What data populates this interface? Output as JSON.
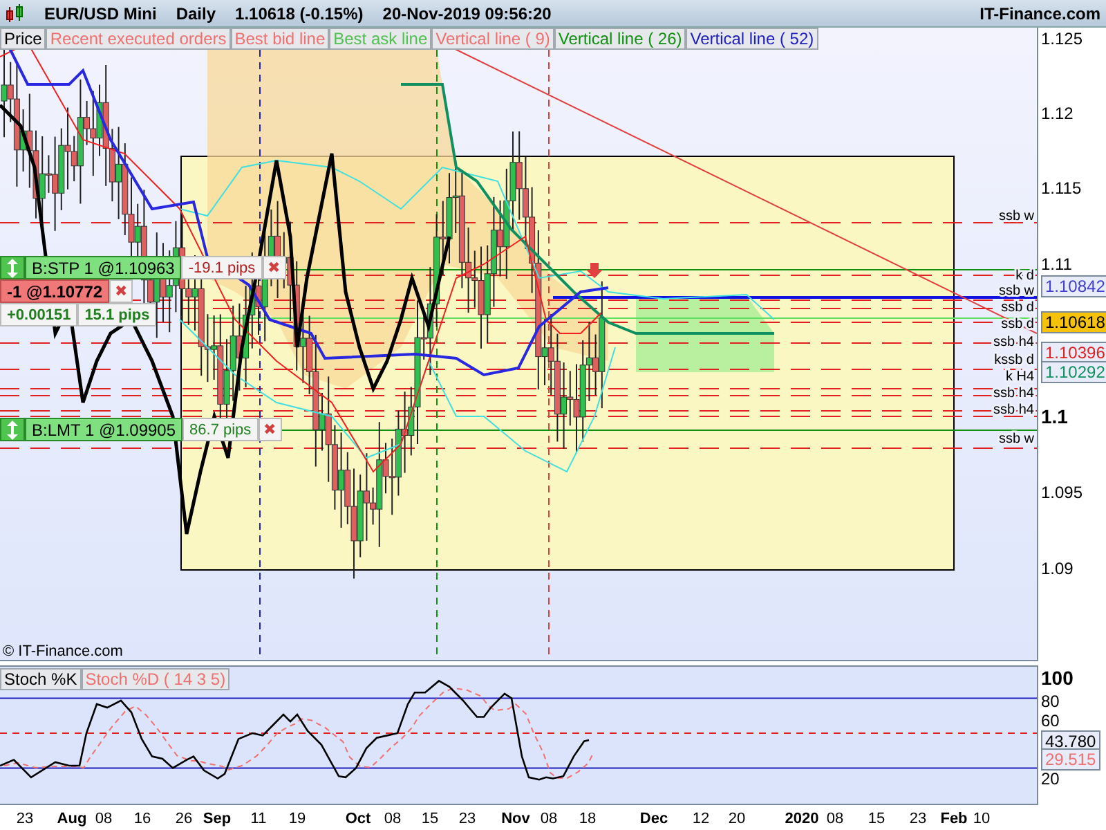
{
  "header": {
    "symbol": "EUR/USD Mini",
    "period": "Daily",
    "quote": "1.10618 (-0.15%)",
    "datetime": "20-Nov-2019 09:56:20",
    "brand": "IT-Finance.com"
  },
  "legend": [
    {
      "label": "Price",
      "color": "#000000"
    },
    {
      "label": "Recent executed orders",
      "color": "#f07070"
    },
    {
      "label": "Best bid line",
      "color": "#f07070"
    },
    {
      "label": "Best ask line",
      "color": "#50c050"
    },
    {
      "label": "Vertical line ( 9)",
      "color": "#f07070"
    },
    {
      "label": "Vertical line ( 26)",
      "color": "#109010"
    },
    {
      "label": "Vertical line ( 52)",
      "color": "#2020c0"
    }
  ],
  "orders": [
    {
      "label": "B:STP  1 @1.10963",
      "pips": "-19.1 pips",
      "close": "✖",
      "profit": false
    },
    {
      "label": "B:LMT  1 @1.09905",
      "pips": "86.7 pips",
      "close": "✖",
      "profit": true
    }
  ],
  "position": {
    "label": "-1 @1.10772",
    "close": "✖",
    "change": "+0.00151",
    "pips": "15.1 pips"
  },
  "level_labels": [
    "ssb w",
    "k d",
    "ssb w",
    "ssb d",
    "ssb d",
    "ssb h4",
    "kssb d",
    "k H4",
    "ssb h4",
    "ssb h4",
    "ssb w"
  ],
  "copyright": "© IT-Finance.com",
  "price_axis": [
    {
      "label": "1.125",
      "kind": "minor"
    },
    {
      "label": "1.12",
      "kind": "minor"
    },
    {
      "label": "1.115",
      "kind": "minor"
    },
    {
      "label": "1.11",
      "kind": "minor"
    },
    {
      "label": "1.1",
      "kind": "major"
    },
    {
      "label": "1.095",
      "kind": "minor"
    },
    {
      "label": "1.09",
      "kind": "minor"
    }
  ],
  "price_tags": [
    {
      "text": "1.10842",
      "color": "#4040d0",
      "current": false
    },
    {
      "text": "1.10618",
      "current": true
    },
    {
      "text": "1.10396",
      "color": "#e02020",
      "current": false
    },
    {
      "text": "1.10292",
      "color": "#109060",
      "current": false
    }
  ],
  "stoch": {
    "legend": [
      {
        "label": "Stoch %K",
        "color": "#000000"
      },
      {
        "label": "Stoch %D ( 14 3 5)",
        "color": "#f07070"
      }
    ],
    "axis": [
      {
        "label": "100",
        "kind": "major"
      },
      {
        "label": "80",
        "kind": "minor"
      },
      {
        "label": "60",
        "kind": "minor"
      },
      {
        "label": "20",
        "kind": "minor"
      }
    ],
    "tags": [
      {
        "text": "43.780",
        "color": "#000000"
      },
      {
        "text": "29.515",
        "color": "#f07070"
      }
    ]
  },
  "time_axis": [
    {
      "label": "23",
      "kind": "day"
    },
    {
      "label": "Aug",
      "kind": "month"
    },
    {
      "label": "08",
      "kind": "day"
    },
    {
      "label": "16",
      "kind": "day"
    },
    {
      "label": "26",
      "kind": "day"
    },
    {
      "label": "Sep",
      "kind": "month"
    },
    {
      "label": "11",
      "kind": "day"
    },
    {
      "label": "19",
      "kind": "day"
    },
    {
      "label": "Oct",
      "kind": "month"
    },
    {
      "label": "08",
      "kind": "day"
    },
    {
      "label": "15",
      "kind": "day"
    },
    {
      "label": "23",
      "kind": "day"
    },
    {
      "label": "Nov",
      "kind": "month"
    },
    {
      "label": "08",
      "kind": "day"
    },
    {
      "label": "18",
      "kind": "day"
    },
    {
      "label": "Dec",
      "kind": "month"
    },
    {
      "label": "12",
      "kind": "day"
    },
    {
      "label": "20",
      "kind": "day"
    },
    {
      "label": "2020",
      "kind": "month"
    },
    {
      "label": "08",
      "kind": "day"
    },
    {
      "label": "15",
      "kind": "day"
    },
    {
      "label": "23",
      "kind": "day"
    },
    {
      "label": "Feb",
      "kind": "month"
    },
    {
      "label": "10",
      "kind": "day"
    }
  ]
}
